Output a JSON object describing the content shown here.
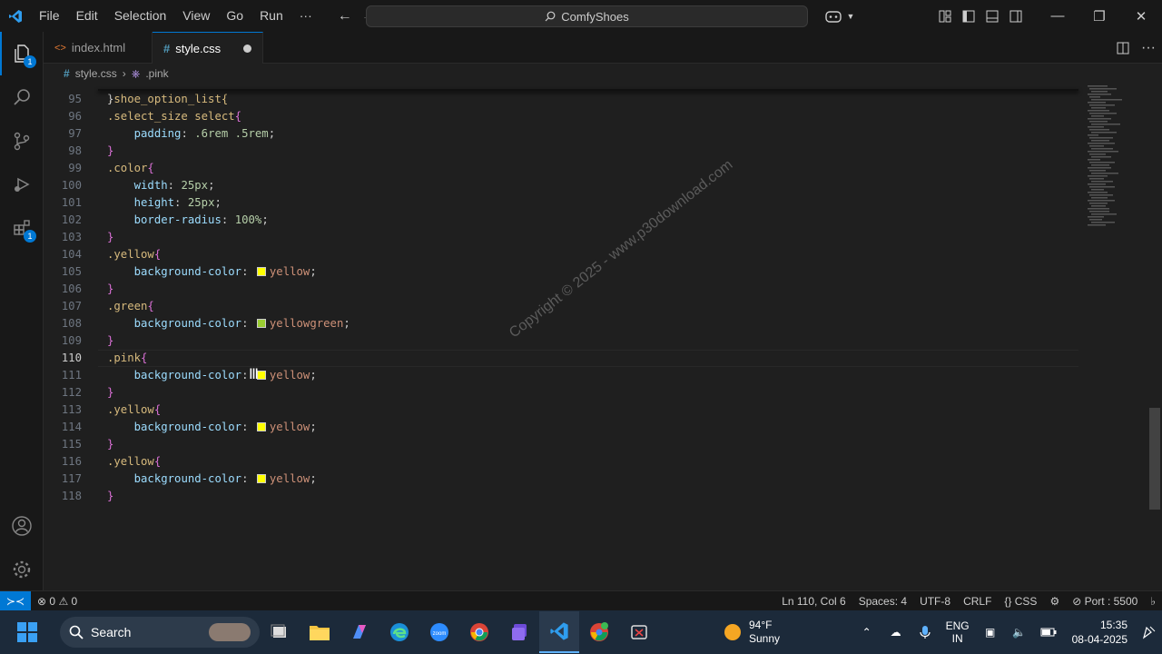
{
  "titlebar": {
    "menu": [
      "File",
      "Edit",
      "Selection",
      "View",
      "Go",
      "Run",
      "···"
    ],
    "command_center": "ComfyShoes",
    "colors": {
      "accent": "#0078d4"
    }
  },
  "activity_bar": {
    "explorer_badge": "1",
    "extensions_badge": "1"
  },
  "tabs": [
    {
      "label": "index.html",
      "icon": "html-icon",
      "active": false
    },
    {
      "label": "style.css",
      "icon": "css-hash-icon",
      "active": true,
      "modified": true
    }
  ],
  "breadcrumb": {
    "file": "style.css",
    "symbol": ".pink"
  },
  "editor": {
    "top_partial": ".shoe_option_list{",
    "lines": [
      {
        "n": "95",
        "parts": [
          [
            "punc",
            "}"
          ]
        ]
      },
      {
        "n": "96",
        "parts": [
          [
            "sel",
            ".select_size select"
          ],
          [
            "brace",
            "{"
          ]
        ]
      },
      {
        "n": "97",
        "parts": [
          [
            "ind",
            "    "
          ],
          [
            "prop",
            "padding"
          ],
          [
            "punc",
            ": "
          ],
          [
            "num",
            ".6rem .5rem"
          ],
          [
            "punc",
            ";"
          ]
        ]
      },
      {
        "n": "98",
        "parts": [
          [
            "brace",
            "}"
          ]
        ]
      },
      {
        "n": "99",
        "parts": [
          [
            "sel",
            ".color"
          ],
          [
            "brace",
            "{"
          ]
        ]
      },
      {
        "n": "100",
        "parts": [
          [
            "ind",
            "    "
          ],
          [
            "prop",
            "width"
          ],
          [
            "punc",
            ": "
          ],
          [
            "num",
            "25px"
          ],
          [
            "punc",
            ";"
          ]
        ]
      },
      {
        "n": "101",
        "parts": [
          [
            "ind",
            "    "
          ],
          [
            "prop",
            "height"
          ],
          [
            "punc",
            ": "
          ],
          [
            "num",
            "25px"
          ],
          [
            "punc",
            ";"
          ]
        ]
      },
      {
        "n": "102",
        "parts": [
          [
            "ind",
            "    "
          ],
          [
            "prop",
            "border-radius"
          ],
          [
            "punc",
            ": "
          ],
          [
            "num",
            "100%"
          ],
          [
            "punc",
            ";"
          ]
        ]
      },
      {
        "n": "103",
        "parts": [
          [
            "brace",
            "}"
          ]
        ]
      },
      {
        "n": "104",
        "parts": [
          [
            "sel",
            ".yellow"
          ],
          [
            "brace",
            "{"
          ]
        ]
      },
      {
        "n": "105",
        "parts": [
          [
            "ind",
            "    "
          ],
          [
            "prop",
            "background-color"
          ],
          [
            "punc",
            ": "
          ],
          [
            "swatch",
            "#ffff00"
          ],
          [
            "val",
            "yellow"
          ],
          [
            "punc",
            ";"
          ]
        ]
      },
      {
        "n": "106",
        "parts": [
          [
            "brace",
            "}"
          ]
        ]
      },
      {
        "n": "107",
        "parts": [
          [
            "sel",
            ".green"
          ],
          [
            "brace",
            "{"
          ]
        ]
      },
      {
        "n": "108",
        "parts": [
          [
            "ind",
            "    "
          ],
          [
            "prop",
            "background-color"
          ],
          [
            "punc",
            ": "
          ],
          [
            "swatch",
            "#9acd32"
          ],
          [
            "val",
            "yellowgreen"
          ],
          [
            "punc",
            ";"
          ]
        ]
      },
      {
        "n": "109",
        "parts": [
          [
            "brace",
            "}"
          ]
        ]
      },
      {
        "n": "110",
        "parts": [
          [
            "sel",
            ".pink"
          ],
          [
            "brace",
            "{"
          ]
        ],
        "current": true
      },
      {
        "n": "111",
        "parts": [
          [
            "ind",
            "    "
          ],
          [
            "prop",
            "background-color"
          ],
          [
            "punc",
            ": "
          ],
          [
            "swatch",
            "#ffff00"
          ],
          [
            "val",
            "yellow"
          ],
          [
            "punc",
            ";"
          ]
        ]
      },
      {
        "n": "112",
        "parts": [
          [
            "brace",
            "}"
          ]
        ]
      },
      {
        "n": "113",
        "parts": [
          [
            "sel",
            ".yellow"
          ],
          [
            "brace",
            "{"
          ]
        ]
      },
      {
        "n": "114",
        "parts": [
          [
            "ind",
            "    "
          ],
          [
            "prop",
            "background-color"
          ],
          [
            "punc",
            ": "
          ],
          [
            "swatch",
            "#ffff00"
          ],
          [
            "val",
            "yellow"
          ],
          [
            "punc",
            ";"
          ]
        ]
      },
      {
        "n": "115",
        "parts": [
          [
            "brace",
            "}"
          ]
        ]
      },
      {
        "n": "116",
        "parts": [
          [
            "sel",
            ".yellow"
          ],
          [
            "brace",
            "{"
          ]
        ]
      },
      {
        "n": "117",
        "parts": [
          [
            "ind",
            "    "
          ],
          [
            "prop",
            "background-color"
          ],
          [
            "punc",
            ": "
          ],
          [
            "swatch",
            "#ffff00"
          ],
          [
            "val",
            "yellow"
          ],
          [
            "punc",
            ";"
          ]
        ]
      },
      {
        "n": "118",
        "parts": [
          [
            "brace",
            "}"
          ]
        ]
      }
    ],
    "watermark": "Copyright © 2025 - www.p30download.com"
  },
  "statusbar": {
    "errors": "0",
    "warnings": "0",
    "position": "Ln 110, Col 6",
    "spaces": "Spaces: 4",
    "encoding": "UTF-8",
    "eol": "CRLF",
    "language": "{} CSS",
    "port": "Port : 5500"
  },
  "taskbar": {
    "search_placeholder": "Search",
    "temp": "94°F",
    "condition": "Sunny",
    "lang_top": "ENG",
    "lang_bottom": "IN",
    "time": "15:35",
    "date": "08-04-2025"
  }
}
